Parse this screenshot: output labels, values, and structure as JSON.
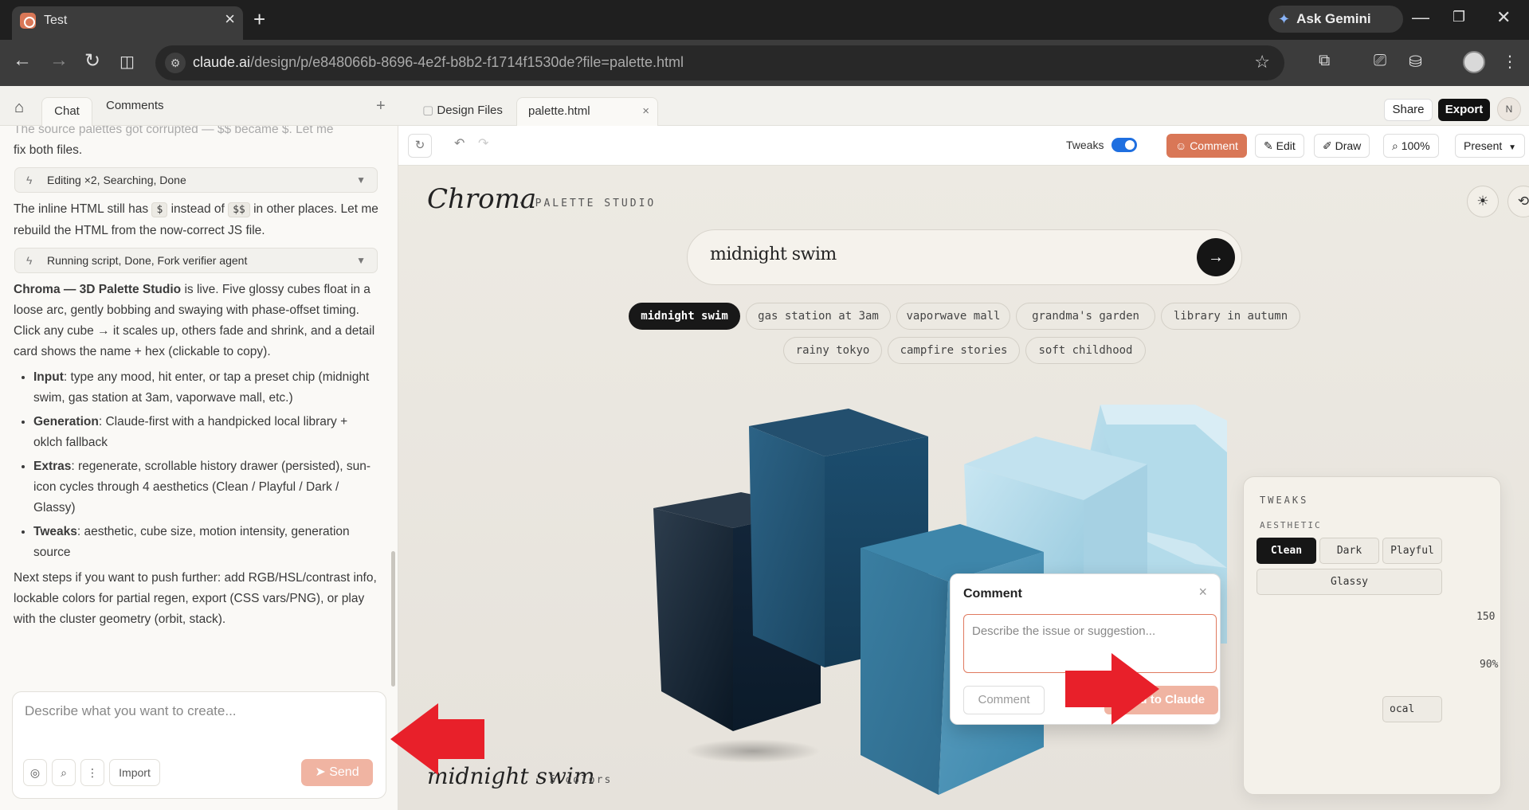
{
  "browser": {
    "tab_title": "Test",
    "url_domain": "claude.ai",
    "url_path": "/design/p/e848066b-8696-4e2f-b8b2-f1714f1530de?file=palette.html",
    "gemini_label": "Ask Gemini"
  },
  "left_panel": {
    "tabs": {
      "chat": "Chat",
      "comments": "Comments"
    },
    "faded_line": "The source palettes got corrupted — $$ became $. Let me",
    "intro_line": "fix both files.",
    "tool_1": "Editing ×2, Searching, Done",
    "p2_a": "The inline HTML still has",
    "p2_code1": "$",
    "p2_b": "instead of",
    "p2_code2": "$$",
    "p2_c": "in other places. Let me rebuild the HTML from the now-correct JS file.",
    "tool_2": "Running script, Done, Fork verifier agent",
    "p3_bold": "Chroma — 3D Palette Studio",
    "p3_rest": "is live. Five glossy cubes float in a loose arc, gently bobbing and swaying with phase-offset timing. Click any cube → it scales up, others fade and shrink, and a detail card shows the name + hex (clickable to copy).",
    "bullets": [
      {
        "label": "Input",
        "text": ": type any mood, hit enter, or tap a preset chip (midnight swim, gas station at 3am, vaporwave mall, etc.)"
      },
      {
        "label": "Generation",
        "text": ": Claude-first with a handpicked local library + oklch fallback"
      },
      {
        "label": "Extras",
        "text": ": regenerate, scrollable history drawer (persisted), sun-icon cycles through 4 aesthetics (Clean / Playful / Dark / Glassy)"
      },
      {
        "label": "Tweaks",
        "text": ": aesthetic, cube size, motion intensity, generation source"
      }
    ],
    "p4": "Next steps if you want to push further: add RGB/HSL/contrast info, lockable colors for partial regen, export (CSS vars/PNG), or play with the cluster geometry (orbit, stack).",
    "composer_placeholder": "Describe what you want to create...",
    "import_label": "Import",
    "send_label": "Send"
  },
  "right_panel": {
    "tabs": {
      "design_files": "Design Files",
      "palette": "palette.html"
    },
    "share_label": "Share",
    "export_label": "Export",
    "user_initial": "N",
    "toolbar": {
      "tweaks_label": "Tweaks",
      "tweaks_on": true,
      "comment_label": "Comment",
      "edit_label": "Edit",
      "draw_label": "Draw",
      "zoom_label": "100%",
      "present_label": "Present"
    }
  },
  "canvas": {
    "logo": "Chroma",
    "logo_sub": "· PALETTE STUDIO",
    "search_value": "midnight swim",
    "chips": [
      "midnight swim",
      "gas station at 3am",
      "vaporwave mall",
      "grandma's garden",
      "library in autumn",
      "rainy tokyo",
      "campfire stories",
      "soft childhood"
    ],
    "selected_chip": "midnight swim",
    "palette_name": "midnight swim",
    "palette_count": "· 5 colors",
    "cube_colors": [
      "#0f2233",
      "#1f4f6e",
      "#3f86a8",
      "#a8d4e6"
    ]
  },
  "tweaks": {
    "title": "TWEAKS",
    "aesthetic_label": "AESTHETIC",
    "options": [
      "Clean",
      "Dark",
      "Playful",
      "Glassy"
    ],
    "selected": "Clean",
    "value_1": "150",
    "value_2": "90%",
    "partial_label": "ocal"
  },
  "comment_popup": {
    "title": "Comment",
    "placeholder": "Describe the issue or suggestion...",
    "comment_label": "Comment",
    "send_label": "Send to Claude"
  },
  "accent_colors": {
    "claude_orange": "#d97757",
    "toggle_blue": "#1f6fe0",
    "arrow_red": "#e8202a"
  }
}
